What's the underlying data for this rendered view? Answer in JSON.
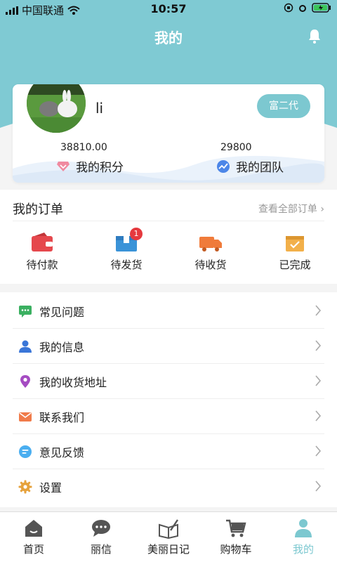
{
  "status_bar": {
    "carrier": "中国联通",
    "time": "10:57"
  },
  "header": {
    "title": "我的"
  },
  "profile": {
    "username": "li",
    "tag": "富二代",
    "points_value": "38810.00",
    "points_label": "我的积分",
    "team_value": "29800",
    "team_label": "我的团队"
  },
  "orders": {
    "title": "我的订单",
    "view_all": "查看全部订单",
    "items": [
      {
        "label": "待付款",
        "icon": "wallet-icon",
        "color": "#e5484d"
      },
      {
        "label": "待发货",
        "icon": "box-icon",
        "color": "#3a93d8",
        "badge": "1"
      },
      {
        "label": "待收货",
        "icon": "truck-icon",
        "color": "#f07b3a"
      },
      {
        "label": "已完成",
        "icon": "done-box-icon",
        "color": "#f2b04a"
      }
    ]
  },
  "menu": [
    {
      "label": "常见问题",
      "icon": "faq-icon",
      "color": "#3bb061"
    },
    {
      "label": "我的信息",
      "icon": "user-icon",
      "color": "#3a76d8"
    },
    {
      "label": "我的收货地址",
      "icon": "location-icon",
      "color": "#a54cc2"
    },
    {
      "label": "联系我们",
      "icon": "mail-icon",
      "color": "#f07b4a"
    },
    {
      "label": "意见反馈",
      "icon": "feedback-icon",
      "color": "#4aaef0"
    },
    {
      "label": "设置",
      "icon": "gear-icon",
      "color": "#e6a23c"
    }
  ],
  "tabbar": [
    {
      "label": "首页",
      "icon": "home-icon"
    },
    {
      "label": "丽信",
      "icon": "chat-icon"
    },
    {
      "label": "美丽日记",
      "icon": "diary-icon"
    },
    {
      "label": "购物车",
      "icon": "cart-icon"
    },
    {
      "label": "我的",
      "icon": "profile-icon",
      "active": true
    }
  ],
  "colors": {
    "header_bg": "#7fcad3",
    "accent": "#7cc8d0",
    "badge": "#e5393e"
  }
}
